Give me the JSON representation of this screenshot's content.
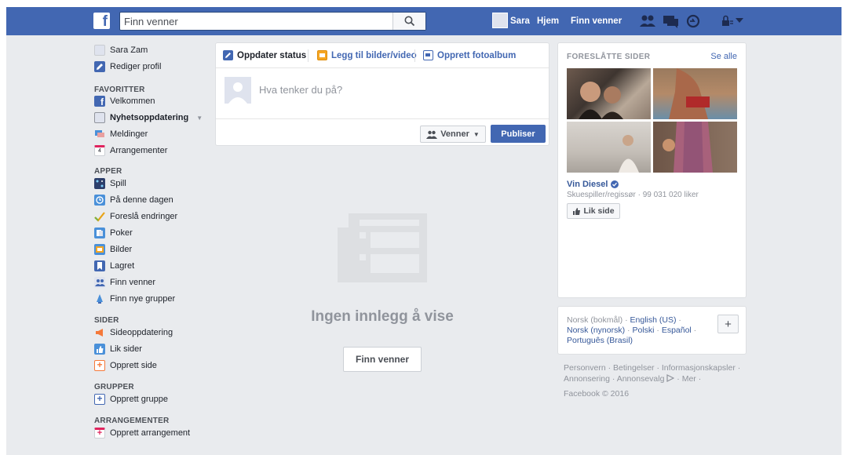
{
  "topbar": {
    "search_placeholder": "Finn venner",
    "profile_name": "Sara",
    "home_label": "Hjem",
    "find_friends_label": "Finn venner",
    "icons": [
      "friend-requests-icon",
      "messages-icon",
      "notifications-icon",
      "privacy-shortcuts-icon",
      "account-menu-caret-icon"
    ]
  },
  "sidebar": {
    "profile_name": "Sara Zam",
    "edit_profile": "Rediger profil",
    "favorites_title": "FAVORITTER",
    "favorites": [
      {
        "label": "Velkommen",
        "icon": "facebook-icon"
      },
      {
        "label": "Nyhetsoppdatering",
        "icon": "news-feed-icon"
      },
      {
        "label": "Meldinger",
        "icon": "messages-icon"
      },
      {
        "label": "Arrangementer",
        "icon": "calendar-icon"
      }
    ],
    "apps_title": "APPER",
    "apps": [
      {
        "label": "Spill",
        "icon": "games-icon"
      },
      {
        "label": "På denne dagen",
        "icon": "on-this-day-icon"
      },
      {
        "label": "Foreslå endringer",
        "icon": "checkmark-icon"
      },
      {
        "label": "Poker",
        "icon": "poker-icon"
      },
      {
        "label": "Bilder",
        "icon": "photos-icon"
      },
      {
        "label": "Lagret",
        "icon": "bookmark-icon"
      },
      {
        "label": "Finn venner",
        "icon": "find-friends-icon"
      },
      {
        "label": "Finn nye grupper",
        "icon": "groups-icon"
      }
    ],
    "pages_title": "SIDER",
    "pages": [
      {
        "label": "Sideoppdatering",
        "icon": "megaphone-icon"
      },
      {
        "label": "Lik sider",
        "icon": "thumbs-up-icon"
      },
      {
        "label": "Opprett side",
        "icon": "add-page-icon"
      }
    ],
    "groups_title": "GRUPPER",
    "groups": [
      {
        "label": "Opprett gruppe",
        "icon": "add-group-icon"
      }
    ],
    "events_title": "ARRANGEMENTER",
    "events": [
      {
        "label": "Opprett arrangement",
        "icon": "add-event-icon"
      }
    ]
  },
  "composer": {
    "tab_status": "Oppdater status",
    "tab_photo": "Legg til bilder/video",
    "tab_album": "Opprett fotoalbum",
    "placeholder": "Hva tenker du på?",
    "audience": "Venner",
    "publish": "Publiser"
  },
  "feed": {
    "empty_text": "Ingen innlegg å vise",
    "find_friends": "Finn venner"
  },
  "suggested": {
    "title": "FORESLÅTTE SIDER",
    "see_all": "Se alle",
    "page_name": "Vin Diesel",
    "page_meta": "Skuespiller/regissør · 99 031 020 liker",
    "like_button": "Lik side"
  },
  "languages": {
    "current": "Norsk (bokmål)",
    "sep": " · ",
    "links": [
      "English (US)",
      "Norsk (nynorsk)",
      "Polski",
      "Español",
      "Português (Brasil)"
    ],
    "more": "+"
  },
  "footer": {
    "line1": "Personvern · Betingelser · Informasjonskapsler ·",
    "line2": "Annonsering · Annonsevalg",
    "line2b": "· Mer ·",
    "copyright": "Facebook © 2016"
  },
  "colors": {
    "brand": "#4267b2",
    "background": "#e9ebee",
    "link": "#365899",
    "muted": "#90949c"
  }
}
